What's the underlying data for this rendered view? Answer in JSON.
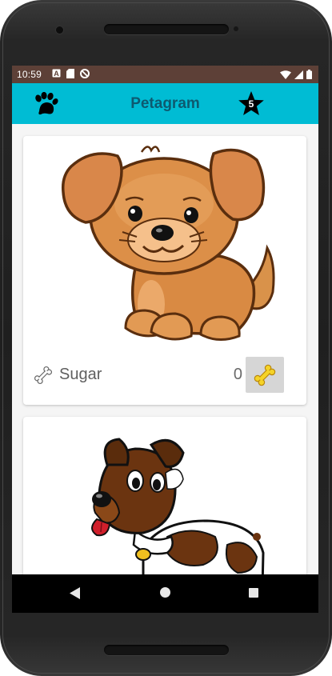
{
  "status_bar": {
    "time": "10:59",
    "left_icons": [
      "notification-a-icon",
      "sd-card-icon",
      "sync-icon"
    ],
    "right_icons": [
      "wifi-icon",
      "signal-icon",
      "battery-icon"
    ]
  },
  "app_bar": {
    "title": "Petagram",
    "left_icon": "paw-icon",
    "favorites_icon": "star-icon",
    "favorites_count": "5",
    "background": "#00bcd4",
    "title_color": "#0d5a70"
  },
  "pets": [
    {
      "name": "Sugar",
      "likes": "0",
      "image": "puppy-illustration",
      "bone_icon": "bone-outline-icon",
      "like_icon": "bone-yellow-icon"
    },
    {
      "name": "",
      "likes": "",
      "image": "spotted-dog-illustration"
    }
  ],
  "nav_bar": {
    "buttons": [
      "back-button",
      "home-button",
      "recents-button"
    ]
  }
}
